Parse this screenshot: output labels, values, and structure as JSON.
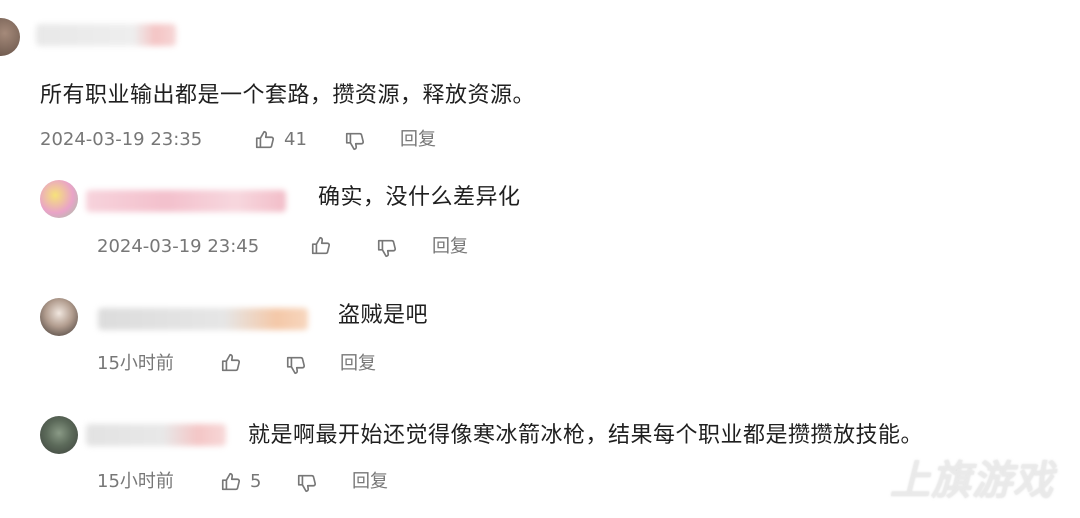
{
  "comments": [
    {
      "text": "所有职业输出都是一个套路，攒资源，释放资源。",
      "time": "2024-03-19 23:35",
      "likes": "41",
      "reply_label": "回复"
    },
    {
      "text": "确实，没什么差异化",
      "time": "2024-03-19 23:45",
      "likes": "",
      "reply_label": "回复"
    },
    {
      "text": "盗贼是吧",
      "time": "15小时前",
      "likes": "",
      "reply_label": "回复"
    },
    {
      "text": "就是啊最开始还觉得像寒冰箭冰枪，结果每个职业都是攒攒放技能。",
      "time": "15小时前",
      "likes": "5",
      "reply_label": "回复"
    }
  ],
  "watermark": "上旗游戏",
  "colors": {
    "text": "#1f1f1f",
    "meta": "#777777",
    "background": "#ffffff"
  },
  "icons": [
    "thumbs-up-icon",
    "thumbs-down-icon"
  ]
}
